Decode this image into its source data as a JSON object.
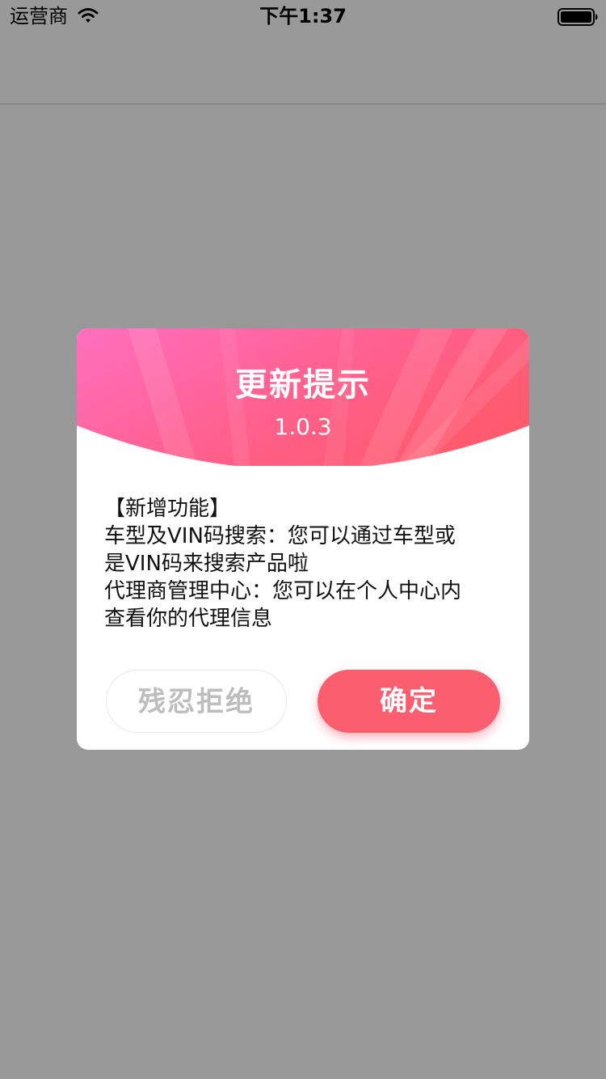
{
  "status_bar": {
    "carrier": "运营商",
    "time": "下午1:37",
    "wifi_icon": "wifi-icon",
    "battery_icon": "battery-icon"
  },
  "dialog": {
    "title": "更新提示",
    "version": "1.0.3",
    "body_lines": [
      "【新增功能】",
      "车型及VIN码搜索：您可以通过车型或",
      "是VIN码来搜索产品啦",
      "代理商管理中心：您可以在个人中心内",
      "查看你的代理信息"
    ],
    "cancel_label": "残忍拒绝",
    "confirm_label": "确定"
  },
  "colors": {
    "overlay": "#999999",
    "accent": "#fb5e6f",
    "header_gradient_start": "#ff6fbf",
    "header_gradient_end": "#ff5a6e"
  }
}
